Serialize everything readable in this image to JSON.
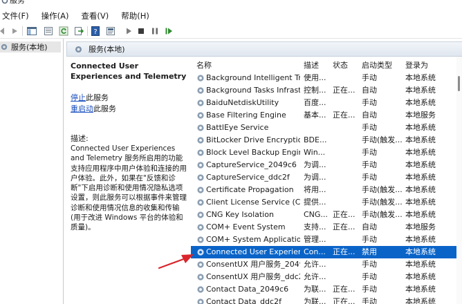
{
  "window": {
    "title": "服务"
  },
  "menu": [
    "文件(F)",
    "操作(A)",
    "查看(V)",
    "帮助(H)"
  ],
  "toolbar": {
    "icons": [
      "back-icon",
      "forward-icon",
      "console-tree-icon",
      "properties-list-icon",
      "refresh-icon",
      "export-icon",
      "help-icon",
      "mmc-icon",
      "start-icon",
      "stop-icon",
      "pause-icon",
      "restart-icon"
    ]
  },
  "tree": {
    "item": "服务(本地)"
  },
  "header": {
    "title": "服务(本地)"
  },
  "detail": {
    "title": "Connected User Experiences and Telemetry",
    "stop_link": "停止",
    "stop_suffix": "此服务",
    "restart_link": "重启动",
    "restart_suffix": "此服务",
    "desc_label": "描述:",
    "description": "Connected User Experiences and Telemetry 服务所启用的功能支持应用程序中用户体验和连接的用户体验。此外，如果在\"反馈和诊断\"下启用诊断和使用情况隐私选项设置，则此服务可以根据事件来管理诊断和使用情况信息的收集和传输(用于改进 Windows 平台的体验和质量)。"
  },
  "columns": {
    "name": "名称",
    "desc": "描述",
    "status": "状态",
    "startup": "启动类型",
    "logon": "登录为"
  },
  "services": [
    {
      "name": "Background Intelligent Tra...",
      "desc": "使用...",
      "status": "",
      "startup": "手动",
      "logon": "本地系统",
      "selected": false
    },
    {
      "name": "Background Tasks Infrastru...",
      "desc": "控制...",
      "status": "正在...",
      "startup": "自动",
      "logon": "本地系统",
      "selected": false
    },
    {
      "name": "BaiduNetdiskUtility",
      "desc": "百度...",
      "status": "",
      "startup": "手动",
      "logon": "本地系统",
      "selected": false
    },
    {
      "name": "Base Filtering Engine",
      "desc": "基本...",
      "status": "正在...",
      "startup": "自动",
      "logon": "本地服务",
      "selected": false
    },
    {
      "name": "BattlEye Service",
      "desc": "",
      "status": "",
      "startup": "手动",
      "logon": "本地系统",
      "selected": false
    },
    {
      "name": "BitLocker Drive Encryption ...",
      "desc": "BDE...",
      "status": "",
      "startup": "手动(触发...",
      "logon": "本地系统",
      "selected": false
    },
    {
      "name": "Block Level Backup Engine ...",
      "desc": "Win...",
      "status": "",
      "startup": "手动",
      "logon": "本地系统",
      "selected": false
    },
    {
      "name": "CaptureService_2049c6",
      "desc": "为调...",
      "status": "",
      "startup": "手动",
      "logon": "本地系统",
      "selected": false
    },
    {
      "name": "CaptureService_ddc2f",
      "desc": "为调...",
      "status": "",
      "startup": "手动",
      "logon": "本地系统",
      "selected": false
    },
    {
      "name": "Certificate Propagation",
      "desc": "将用...",
      "status": "",
      "startup": "手动(触发...",
      "logon": "本地系统",
      "selected": false
    },
    {
      "name": "Client License Service (Clip...",
      "desc": "提供...",
      "status": "",
      "startup": "手动(触发...",
      "logon": "本地系统",
      "selected": false
    },
    {
      "name": "CNG Key Isolation",
      "desc": "CNG...",
      "status": "正在...",
      "startup": "手动(触发...",
      "logon": "本地系统",
      "selected": false
    },
    {
      "name": "COM+ Event System",
      "desc": "支持...",
      "status": "正在...",
      "startup": "自动",
      "logon": "本地服务",
      "selected": false
    },
    {
      "name": "COM+ System Application",
      "desc": "管理...",
      "status": "",
      "startup": "手动",
      "logon": "本地系统",
      "selected": false
    },
    {
      "name": "Connected User Experienc...",
      "desc": "Con...",
      "status": "正在...",
      "startup": "禁用",
      "logon": "本地系统",
      "selected": true
    },
    {
      "name": "ConsentUX 用户服务_2049...",
      "desc": "允许...",
      "status": "",
      "startup": "手动",
      "logon": "本地系统",
      "selected": false
    },
    {
      "name": "ConsentUX 用户服务_ddc2f",
      "desc": "允许...",
      "status": "",
      "startup": "手动",
      "logon": "本地系统",
      "selected": false
    },
    {
      "name": "Contact Data_2049c6",
      "desc": "为联...",
      "status": "正在...",
      "startup": "手动",
      "logon": "本地系统",
      "selected": false
    },
    {
      "name": "Contact Data_ddc2f",
      "desc": "为联...",
      "status": "正在...",
      "startup": "手动",
      "logon": "本地系统",
      "selected": false
    }
  ],
  "colors": {
    "selection": "#0a64c8",
    "link": "#1a4fbf",
    "arrow": "#d9262c"
  }
}
